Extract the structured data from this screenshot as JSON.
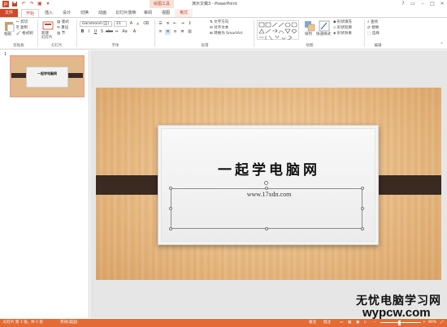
{
  "window": {
    "context_tab_title": "绘图工具",
    "title": "演示文稿3 - PowerPoint"
  },
  "tabs": [
    "文件",
    "开始",
    "插入",
    "设计",
    "切换",
    "动画",
    "幻灯片放映",
    "审阅",
    "视图",
    "格式"
  ],
  "ribbon": {
    "clipboard": {
      "paste": "粘贴",
      "cut": "剪切",
      "copy": "复制",
      "format_painter": "格式刷",
      "group": "剪贴板"
    },
    "slides": {
      "new_slide": "新建\n幻灯片",
      "layout": "版式",
      "reset": "重设",
      "section": "节",
      "group": "幻灯片"
    },
    "font": {
      "font_name": "Garamond (正)",
      "font_size": "21",
      "group": "字体"
    },
    "paragraph": {
      "text_direction": "文字方向",
      "align_text": "对齐文本",
      "convert_smartart": "转换为 SmartArt",
      "group": "段落"
    },
    "drawing": {
      "arrange": "排列",
      "quick_styles": "快速样式",
      "shape_fill": "形状填充",
      "shape_outline": "形状轮廓",
      "shape_effects": "形状效果",
      "group": "绘图"
    },
    "editing": {
      "find": "查找",
      "replace": "替换",
      "select": "选择",
      "group": "编辑"
    }
  },
  "thumbnail": {
    "number": "1",
    "title": "一起学电脑网"
  },
  "slide": {
    "title": "一起学电脑网",
    "url": "www.17xdn.com"
  },
  "watermark": {
    "line1": "无忧电脑学习网",
    "line2": "wypcw.com"
  },
  "status": {
    "slide_info": "幻灯片 第 1 张，共 1 张",
    "language": "英语(美国)",
    "notes": "备注",
    "comments": "批注",
    "zoom": "80%"
  },
  "colors": {
    "accent": "#d24726",
    "status_bar": "#e46c34",
    "band": "#3a2a22"
  }
}
